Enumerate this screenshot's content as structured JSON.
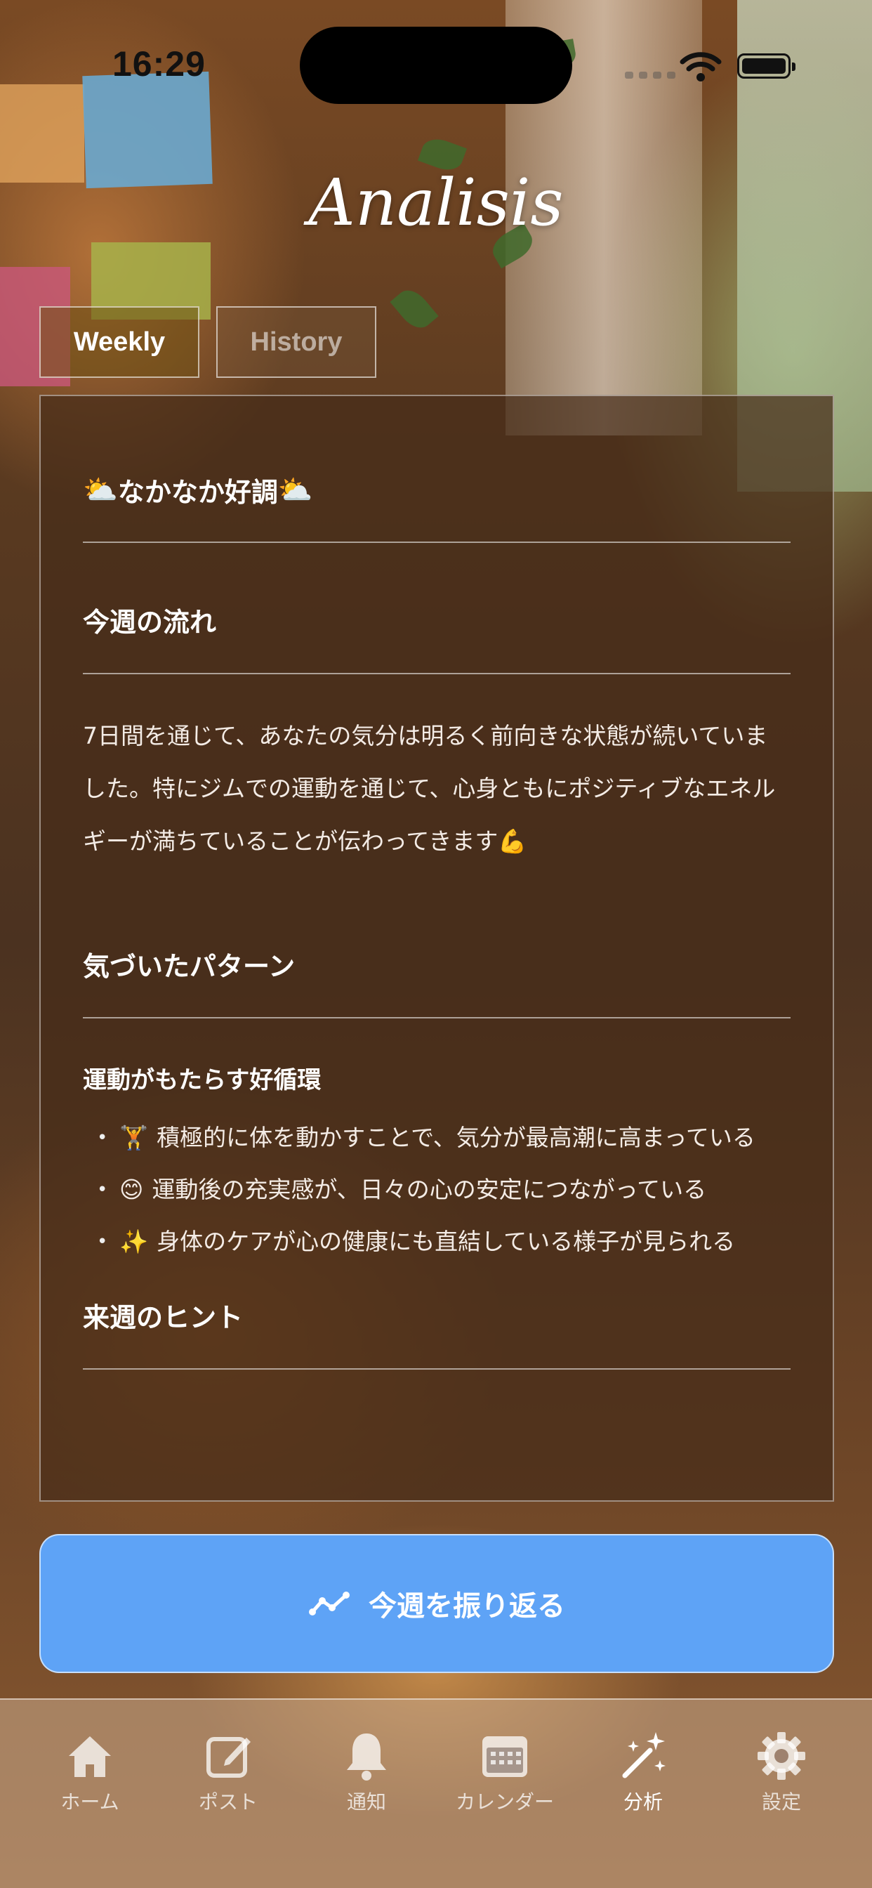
{
  "status_bar": {
    "time": "16:29"
  },
  "title": "Analisis",
  "tabs": [
    {
      "label": "Weekly",
      "active": true
    },
    {
      "label": "History",
      "active": false
    }
  ],
  "card": {
    "headline": "なかなか好調",
    "headline_icon": "sun-behind-cloud-icon",
    "section1_title": "今週の流れ",
    "section1_text": "7日間を通じて、あなたの気分は明るく前向きな状態が続いていました。特にジムでの運動を通じて、心身ともにポジティブなエネルギーが満ちていることが伝わってきます💪",
    "section2_title": "気づいたパターン",
    "section2_subtitle": "運動がもたらす好循環",
    "bullets": [
      {
        "icon": "🏋",
        "text": "積極的に体を動かすことで、気分が最高潮に高まっている"
      },
      {
        "icon": "😊",
        "text": "運動後の充実感が、日々の心の安定につながっている"
      },
      {
        "icon": "✨",
        "text": "身体のケアが心の健康にも直結している様子が見られる"
      }
    ],
    "section3_title": "来週のヒント"
  },
  "cta": {
    "label": "今週を振り返る",
    "icon": "trend-line-icon"
  },
  "tabbar": [
    {
      "label": "ホーム",
      "icon": "home-icon"
    },
    {
      "label": "ポスト",
      "icon": "compose-icon"
    },
    {
      "label": "通知",
      "icon": "bell-icon"
    },
    {
      "label": "カレンダー",
      "icon": "calendar-icon"
    },
    {
      "label": "分析",
      "icon": "magic-wand-icon",
      "active": true
    },
    {
      "label": "設定",
      "icon": "gear-icon"
    }
  ],
  "colors": {
    "cta": "#5ea3f6",
    "card": "rgba(70,45,25,0.72)"
  }
}
